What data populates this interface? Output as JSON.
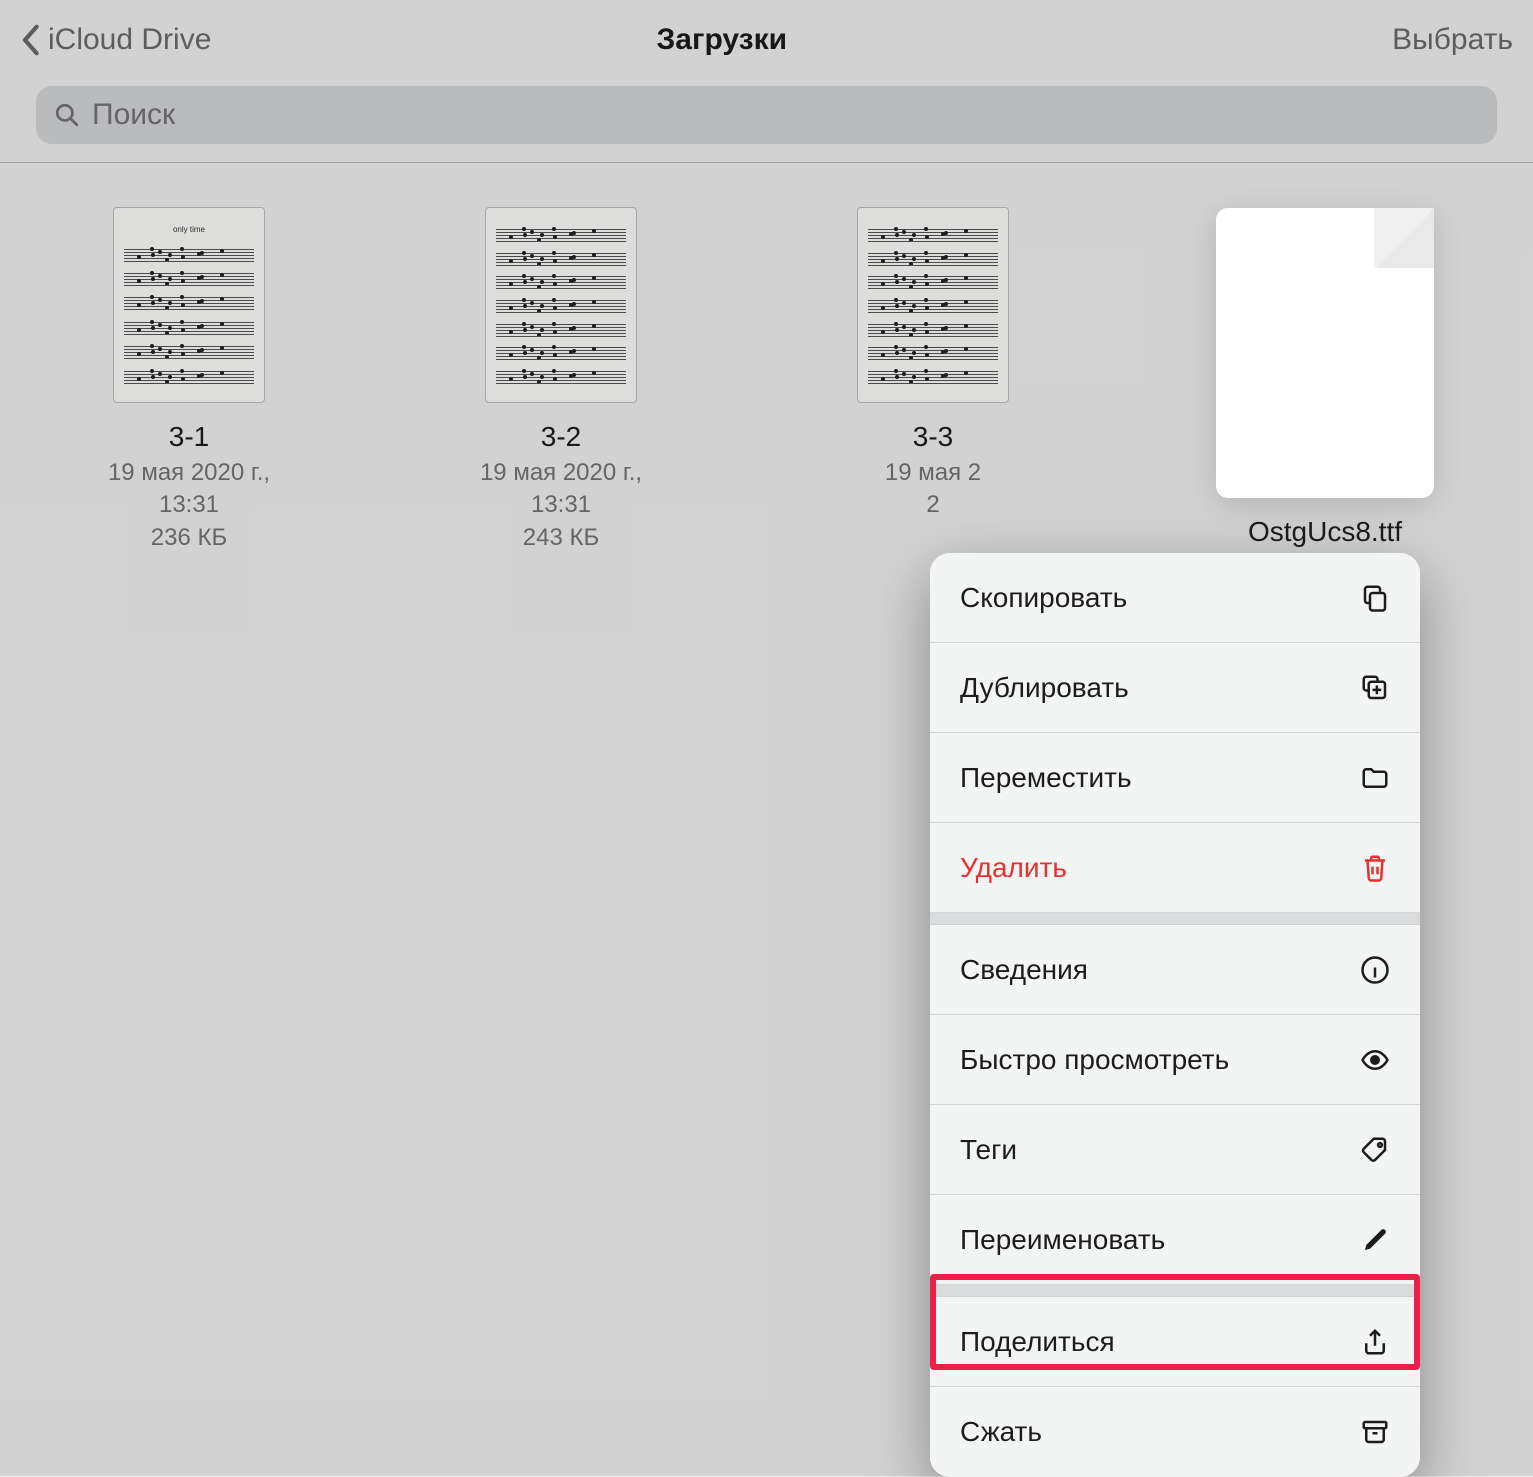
{
  "nav": {
    "back_label": "iCloud Drive",
    "title": "Загрузки",
    "select_label": "Выбрать"
  },
  "search": {
    "placeholder": "Поиск"
  },
  "files": [
    {
      "name": "3-1",
      "date": "19 мая 2020 г., 13:31",
      "size": "236 КБ",
      "thumb_title": "only time"
    },
    {
      "name": "3-2",
      "date": "19 мая 2020 г., 13:31",
      "size": "243 КБ"
    },
    {
      "name": "3-3",
      "date": "19 мая 2",
      "size": "2"
    },
    {
      "name": "OstgUcs8.ttf"
    }
  ],
  "menu": {
    "copy": "Скопировать",
    "duplicate": "Дублировать",
    "move": "Переместить",
    "delete": "Удалить",
    "info": "Сведения",
    "quicklook": "Быстро просмотреть",
    "tags": "Теги",
    "rename": "Переименовать",
    "share": "Поделиться",
    "compress": "Сжать"
  },
  "colors": {
    "danger": "#e7312f",
    "highlight": "#ef1f49"
  }
}
